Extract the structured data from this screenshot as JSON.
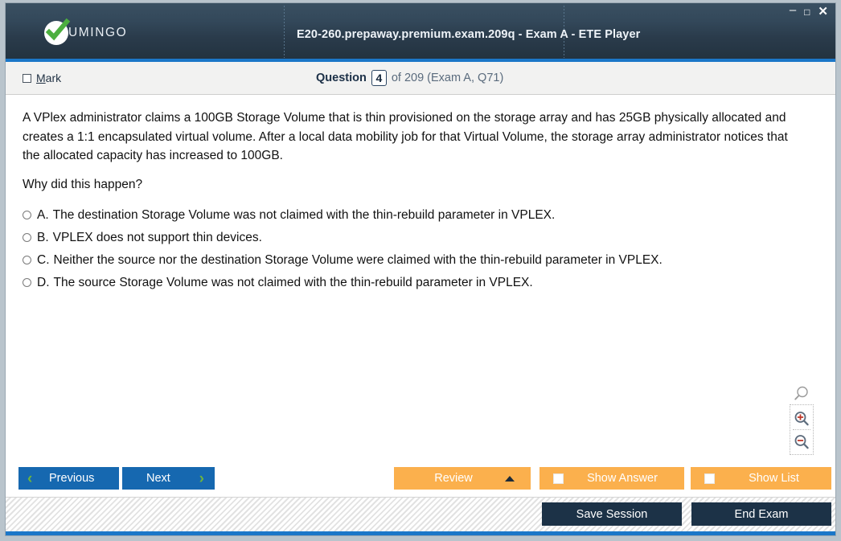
{
  "window": {
    "title": "E20-260.prepaway.premium.exam.209q - Exam A - ETE Player",
    "logo_text": "UMINGO",
    "controls": {
      "minimize": "–",
      "maximize": "□",
      "close": "✕"
    },
    "accent_color": "#1b77c8",
    "titlebar_color": "#2e4253"
  },
  "question_bar": {
    "mark_label_prefix": "",
    "mark_label_accel": "M",
    "mark_label_rest": "ark",
    "mark_checked": false,
    "question_word": "Question",
    "question_number": "4",
    "rest": "of 209 (Exam A, Q71)"
  },
  "question": {
    "text": "A VPlex administrator claims a 100GB Storage Volume that is thin provisioned on the storage array and has 25GB physically allocated and creates a 1:1 encapsulated virtual volume. After a local data mobility job for that Virtual Volume, the storage array administrator notices that the allocated capacity has increased to 100GB.",
    "prompt": "Why did this happen?",
    "choices": [
      {
        "letter": "A.",
        "text": "The destination Storage Volume was not claimed with the thin-rebuild parameter in VPLEX.",
        "selected": false
      },
      {
        "letter": "B.",
        "text": "VPLEX does not support thin devices.",
        "selected": false
      },
      {
        "letter": "C.",
        "text": "Neither the source nor the destination Storage Volume were claimed with the thin-rebuild parameter in VPLEX.",
        "selected": false
      },
      {
        "letter": "D.",
        "text": "The source Storage Volume was not claimed with the thin-rebuild parameter in VPLEX.",
        "selected": false
      }
    ]
  },
  "zoom_tools": {
    "reset_title": "Zoom",
    "zoom_in_title": "Zoom In",
    "zoom_out_title": "Zoom Out"
  },
  "buttons": {
    "previous": "Previous",
    "next": "Next",
    "review": "Review",
    "show_answer": "Show Answer",
    "show_list": "Show List",
    "save_session": "Save Session",
    "end_exam": "End Exam",
    "blue_color": "#1668b0",
    "orange_color": "#fbb04d",
    "dark_color": "#1c3247",
    "chevron_color": "#6cb33f"
  }
}
